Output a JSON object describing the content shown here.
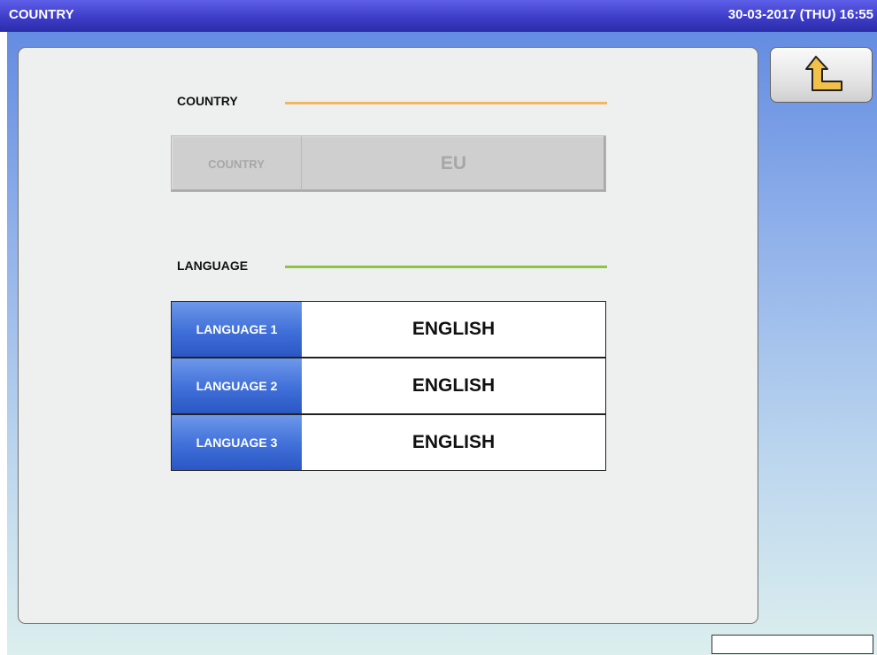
{
  "header": {
    "title": "COUNTRY",
    "datetime": "30-03-2017 (THU)  16:55"
  },
  "back_button": {
    "icon": "return-arrow-icon"
  },
  "country_section": {
    "label": "COUNTRY",
    "line_color": "#f5b45f",
    "row": {
      "key": "COUNTRY",
      "value": "EU",
      "enabled": false
    }
  },
  "language_section": {
    "label": "LANGUAGE",
    "line_color": "#8cc63e",
    "rows": [
      {
        "key": "LANGUAGE 1",
        "value": "ENGLISH"
      },
      {
        "key": "LANGUAGE 2",
        "value": "ENGLISH"
      },
      {
        "key": "LANGUAGE 3",
        "value": "ENGLISH"
      }
    ]
  },
  "status_box": {
    "text": ""
  },
  "colors": {
    "title_bar": "#3d3dc9",
    "key_cell_blue": "#3f6fd8",
    "arrow_fill": "#f2c14a"
  }
}
